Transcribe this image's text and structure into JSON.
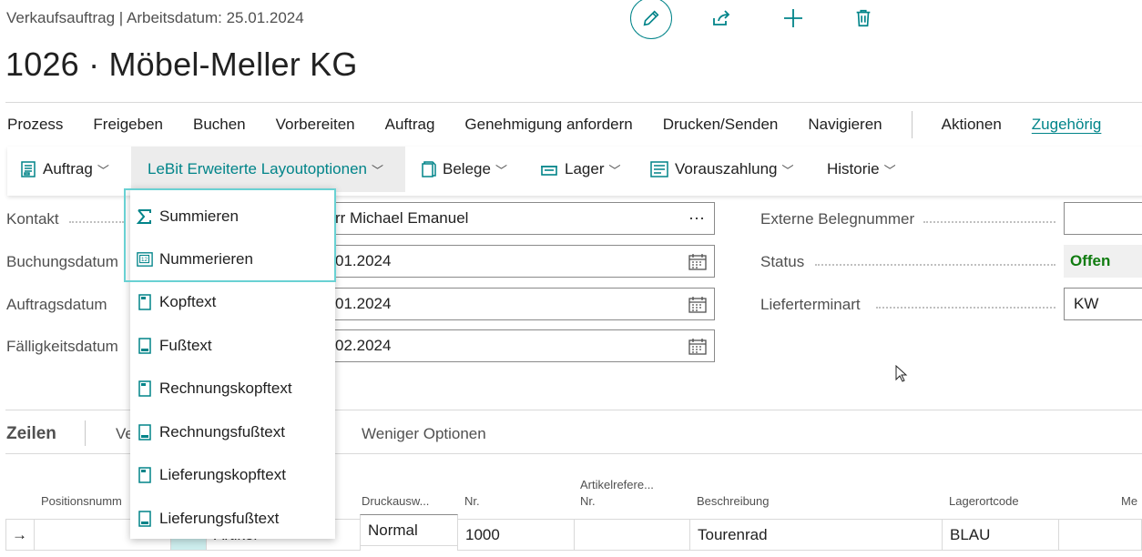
{
  "header": {
    "caption": "Verkaufsauftrag | Arbeitsdatum: 25.01.2024",
    "title": "1026 · Möbel-Meller KG",
    "action_icons": [
      "pencil-icon",
      "share-icon",
      "plus-icon",
      "trash-icon"
    ]
  },
  "menubar": {
    "items": [
      "Prozess",
      "Freigeben",
      "Buchen",
      "Vorbereiten",
      "Auftrag",
      "Genehmigung anfordern",
      "Drucken/Senden",
      "Navigieren"
    ],
    "after_sep": [
      "Aktionen",
      "Zugehörig"
    ],
    "active": "Zugehörig"
  },
  "subbar": {
    "items": [
      {
        "label": "Auftrag",
        "icon": "document-icon"
      },
      {
        "label": "LeBit Erweiterte Layoutoptionen",
        "icon": ""
      },
      {
        "label": "Belege",
        "icon": "pages-icon"
      },
      {
        "label": "Lager",
        "icon": "warehouse-icon"
      },
      {
        "label": "Vorauszahlung",
        "icon": "list-icon"
      },
      {
        "label": "Historie",
        "icon": ""
      }
    ]
  },
  "dropdown": {
    "items": [
      {
        "label": "Summieren",
        "icon": "sigma-icon"
      },
      {
        "label": "Nummerieren",
        "icon": "numbering-icon"
      },
      {
        "label": "Kopftext",
        "icon": "page-icon"
      },
      {
        "label": "Fußtext",
        "icon": "page-footer-icon"
      },
      {
        "label": "Rechnungskopftext",
        "icon": "page-icon"
      },
      {
        "label": "Rechnungsfußtext",
        "icon": "page-footer-icon"
      },
      {
        "label": "Lieferungskopftext",
        "icon": "page-icon"
      },
      {
        "label": "Lieferungsfußtext",
        "icon": "page-footer-icon"
      }
    ]
  },
  "form": {
    "left": [
      {
        "label": "Kontakt",
        "value": "rr Michael Emanuel"
      },
      {
        "label": "Buchungsdatum",
        "value": "01.2024"
      },
      {
        "label": "Auftragsdatum",
        "value": "01.2024"
      },
      {
        "label": "Fälligkeitsdatum",
        "value": "02.2024"
      }
    ],
    "right": [
      {
        "label": "Externe Belegnummer",
        "value": ""
      },
      {
        "label": "Status",
        "value": "Offen"
      },
      {
        "label": "Lieferterminart",
        "value": "KW"
      }
    ],
    "more_icon": "···"
  },
  "lines": {
    "title": "Zeilen",
    "tab_partial": "Ve",
    "fewer_options": "Weniger Optionen",
    "columns": [
      "Positionsnumm",
      "Druckausw...",
      "Nr.",
      "Artikelrefere...",
      "Nr.",
      "Beschreibung",
      "Lagerortcode",
      "Me"
    ],
    "row": {
      "arrow": "→",
      "type": "Artikel",
      "druck": "Normal",
      "nr": "1000",
      "beschreibung": "Tourenrad",
      "lager": "BLAU"
    }
  },
  "colors": {
    "accent": "#008489",
    "status": "#107c10",
    "focus": "#69d1d3"
  }
}
